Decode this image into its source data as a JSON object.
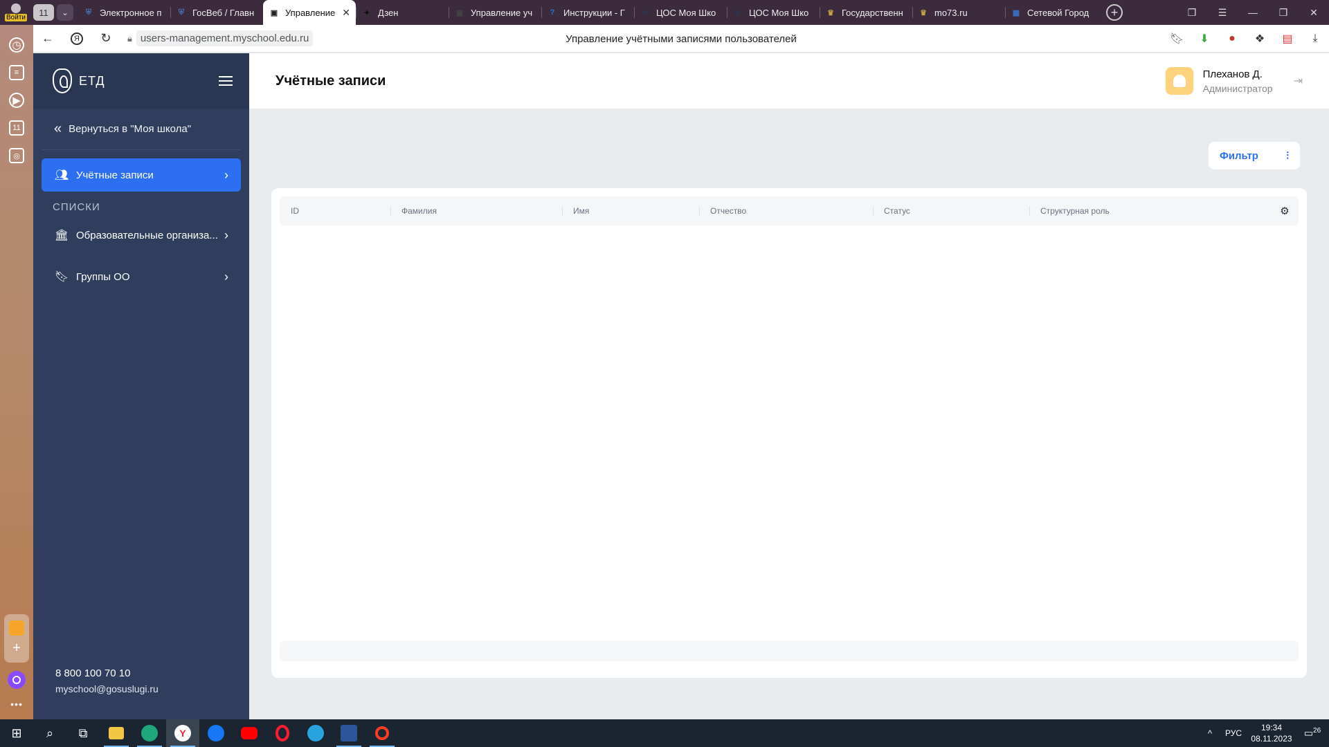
{
  "browser": {
    "tab_count": "11",
    "profile_label": "Войти",
    "tabs": [
      {
        "title": "Электронное п",
        "fav_color": "#4a6fb5",
        "fav_char": "⛨"
      },
      {
        "title": "ГосВеб / Главн",
        "fav_color": "#4a6fb5",
        "fav_char": "⛨"
      },
      {
        "title": "Управление",
        "fav_color": "#222222",
        "fav_char": "▣",
        "active": true
      },
      {
        "title": "Дзен",
        "fav_color": "#111111",
        "fav_char": "✦"
      },
      {
        "title": "Управление уч",
        "fav_color": "#444444",
        "fav_char": "▣"
      },
      {
        "title": "Инструкции - Г",
        "fav_color": "#2d6ff1",
        "fav_char": "?"
      },
      {
        "title": "ЦОС Моя Шко",
        "fav_color": "#2a3753",
        "fav_char": "⚛"
      },
      {
        "title": "ЦОС Моя Шко",
        "fav_color": "#2a3753",
        "fav_char": "⚛"
      },
      {
        "title": "Государственн",
        "fav_color": "#c8a24a",
        "fav_char": "♛"
      },
      {
        "title": "mo73.ru",
        "fav_color": "#c8a24a",
        "fav_char": "♛"
      },
      {
        "title": "Сетевой Город",
        "fav_color": "#3a6fc4",
        "fav_char": "▦"
      }
    ],
    "active_close": "✕",
    "url": "users-management.myschool.edu.ru",
    "page_title": "Управление учётными записями пользователей"
  },
  "sidebar": {
    "brand": "ЕТД",
    "back_label": "Вернуться в \"Моя школа\"",
    "items": [
      {
        "label": "Учётные записи",
        "active": true
      },
      {
        "label": "Образовательные организа...",
        "active": false
      },
      {
        "label": "Группы ОО",
        "active": false
      }
    ],
    "section_lists": "Списки",
    "phone": "8 800 100 70 10",
    "email": "myschool@gosuslugi.ru"
  },
  "header": {
    "title": "Учётные записи",
    "user_name": "Плеханов Д.",
    "user_role": "Администратор"
  },
  "toolbar": {
    "filter_label": "Фильтр"
  },
  "table": {
    "columns": [
      "ID",
      "Фамилия",
      "Имя",
      "Отчество",
      "Статус",
      "Структурная роль"
    ],
    "rows": []
  },
  "taskbar": {
    "lang": "РУС",
    "time": "19:34",
    "date": "08.11.2023",
    "notifications": "26"
  },
  "colors": {
    "accent": "#2d6ff1",
    "sidebar_bg": "#2f3e5c",
    "page_bg": "#e9ecef"
  }
}
